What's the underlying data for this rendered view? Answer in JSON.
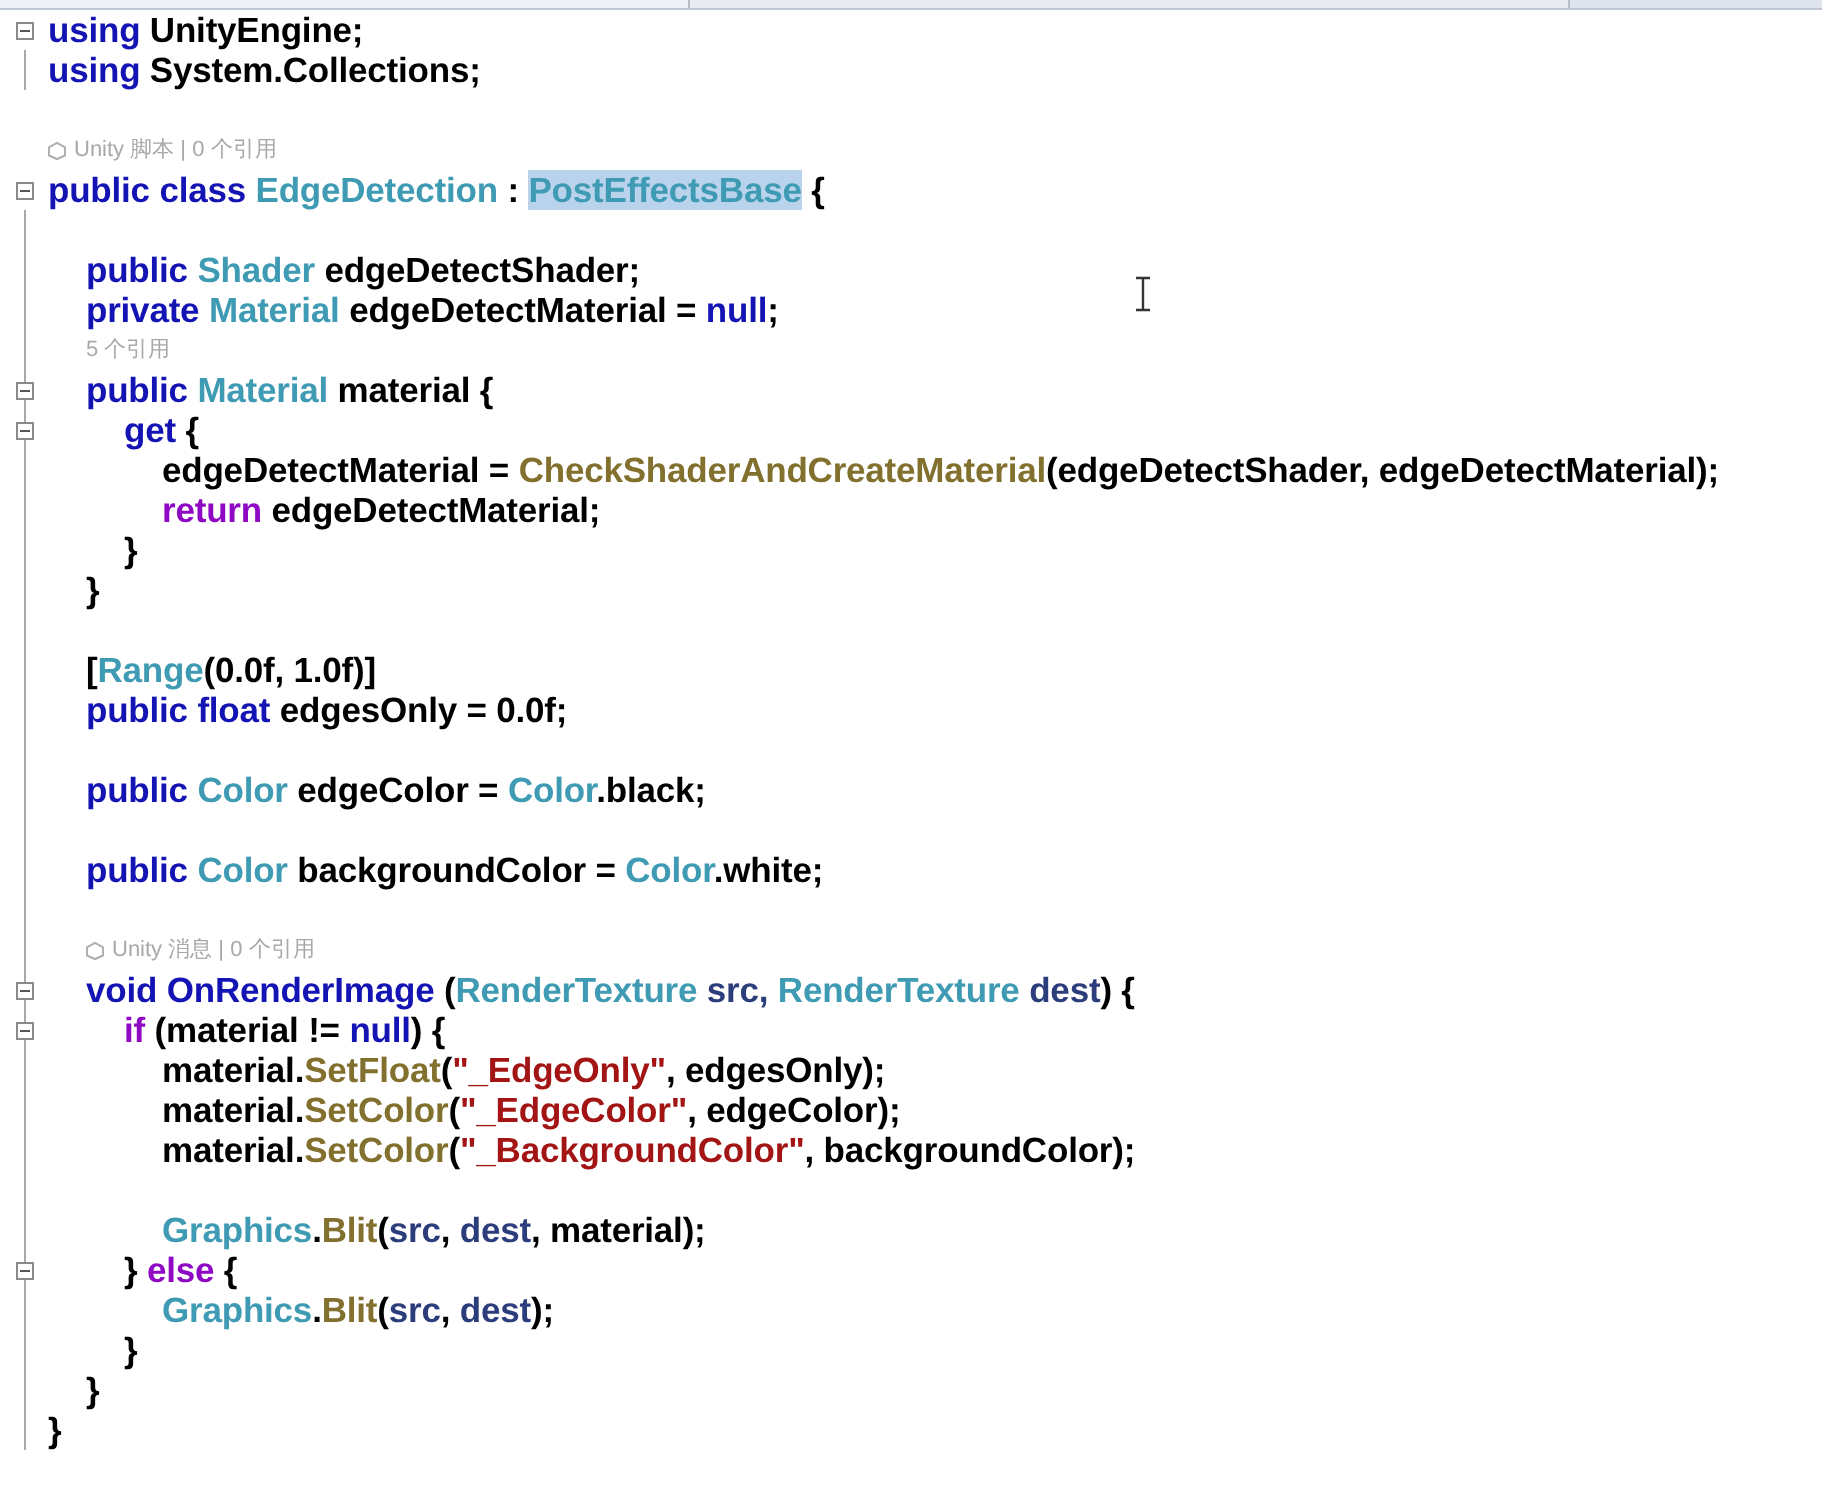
{
  "lines": [
    {
      "kind": "code",
      "fold_box": true,
      "outline": false,
      "tokens": [
        {
          "text": "using",
          "kind": "keyword"
        },
        {
          "text": " UnityEngine;",
          "kind": "plain"
        }
      ]
    },
    {
      "kind": "code",
      "fold_box": false,
      "outline": true,
      "tokens": [
        {
          "text": "using",
          "kind": "keyword"
        },
        {
          "text": " System.Collections;",
          "kind": "plain"
        }
      ]
    },
    {
      "kind": "blank",
      "fold_box": false,
      "outline": false
    },
    {
      "kind": "annotation",
      "fold_box": false,
      "outline": false,
      "indented": false,
      "unity_icon": true,
      "text": "Unity 脚本 | 0 个引用"
    },
    {
      "kind": "code",
      "fold_box": true,
      "outline": false,
      "tokens": [
        {
          "text": "public class",
          "kind": "keyword"
        },
        {
          "text": " EdgeDetection",
          "kind": "type"
        },
        {
          "text": " : ",
          "kind": "plain"
        },
        {
          "text": "PostEffectsBase",
          "kind": "selected_type"
        },
        {
          "text": " {",
          "kind": "plain"
        }
      ]
    },
    {
      "kind": "blank",
      "fold_box": false,
      "outline": true
    },
    {
      "kind": "code",
      "fold_box": false,
      "outline": true,
      "tokens": [
        {
          "text": "\tpublic",
          "kind": "keyword"
        },
        {
          "text": " Shader",
          "kind": "type"
        },
        {
          "text": " edgeDetectShader;",
          "kind": "plain"
        }
      ]
    },
    {
      "kind": "code",
      "fold_box": false,
      "outline": true,
      "tokens": [
        {
          "text": "\tprivate",
          "kind": "keyword"
        },
        {
          "text": " Material",
          "kind": "type"
        },
        {
          "text": " edgeDetectMaterial = ",
          "kind": "plain"
        },
        {
          "text": "null",
          "kind": "keyword"
        },
        {
          "text": ";",
          "kind": "plain"
        }
      ]
    },
    {
      "kind": "annotation",
      "fold_box": false,
      "outline": true,
      "indented": true,
      "unity_icon": false,
      "text": "5 个引用"
    },
    {
      "kind": "code",
      "fold_box": true,
      "outline": true,
      "tokens": [
        {
          "text": "\tpublic",
          "kind": "keyword"
        },
        {
          "text": " Material",
          "kind": "type"
        },
        {
          "text": " material {",
          "kind": "plain"
        }
      ]
    },
    {
      "kind": "code",
      "fold_box": true,
      "outline": true,
      "tokens": [
        {
          "text": "\t\tget",
          "kind": "keyword"
        },
        {
          "text": " {",
          "kind": "plain"
        }
      ]
    },
    {
      "kind": "code",
      "fold_box": false,
      "outline": true,
      "tokens": [
        {
          "text": "\t\t\tedgeDetectMaterial = ",
          "kind": "plain"
        },
        {
          "text": "CheckShaderAndCreateMaterial",
          "kind": "method"
        },
        {
          "text": "(edgeDetectShader, edgeDetectMaterial);",
          "kind": "plain"
        }
      ]
    },
    {
      "kind": "code",
      "fold_box": false,
      "outline": true,
      "tokens": [
        {
          "text": "\t\t\treturn",
          "kind": "control"
        },
        {
          "text": " edgeDetectMaterial;",
          "kind": "plain"
        }
      ]
    },
    {
      "kind": "code",
      "fold_box": false,
      "outline": true,
      "tokens": [
        {
          "text": "\t\t}",
          "kind": "plain"
        }
      ]
    },
    {
      "kind": "code",
      "fold_box": false,
      "outline": true,
      "tokens": [
        {
          "text": "\t}",
          "kind": "plain"
        }
      ]
    },
    {
      "kind": "blank",
      "fold_box": false,
      "outline": true
    },
    {
      "kind": "code",
      "fold_box": false,
      "outline": true,
      "tokens": [
        {
          "text": "\t[",
          "kind": "plain"
        },
        {
          "text": "Range",
          "kind": "type"
        },
        {
          "text": "(0.0f, 1.0f)]",
          "kind": "plain"
        }
      ]
    },
    {
      "kind": "code",
      "fold_box": false,
      "outline": true,
      "tokens": [
        {
          "text": "\tpublic float",
          "kind": "keyword"
        },
        {
          "text": " edgesOnly = 0.0f;",
          "kind": "plain"
        }
      ]
    },
    {
      "kind": "blank",
      "fold_box": false,
      "outline": true
    },
    {
      "kind": "code",
      "fold_box": false,
      "outline": true,
      "tokens": [
        {
          "text": "\tpublic",
          "kind": "keyword"
        },
        {
          "text": " Color",
          "kind": "type"
        },
        {
          "text": " edgeColor = ",
          "kind": "plain"
        },
        {
          "text": "Color",
          "kind": "type"
        },
        {
          "text": ".black;",
          "kind": "plain"
        }
      ]
    },
    {
      "kind": "blank",
      "fold_box": false,
      "outline": true
    },
    {
      "kind": "code",
      "fold_box": false,
      "outline": true,
      "tokens": [
        {
          "text": "\tpublic",
          "kind": "keyword"
        },
        {
          "text": " Color",
          "kind": "type"
        },
        {
          "text": " backgroundColor = ",
          "kind": "plain"
        },
        {
          "text": "Color",
          "kind": "type"
        },
        {
          "text": ".white;",
          "kind": "plain"
        }
      ]
    },
    {
      "kind": "blank",
      "fold_box": false,
      "outline": true
    },
    {
      "kind": "annotation",
      "fold_box": false,
      "outline": true,
      "indented": true,
      "unity_icon": true,
      "text": "Unity 消息 | 0 个引用"
    },
    {
      "kind": "code",
      "fold_box": true,
      "outline": true,
      "tokens": [
        {
          "text": "\tvoid OnRenderImage",
          "kind": "keyword"
        },
        {
          "text": " (",
          "kind": "plain"
        },
        {
          "text": "RenderTexture",
          "kind": "type"
        },
        {
          "text": " src, ",
          "kind": "param"
        },
        {
          "text": "RenderTexture",
          "kind": "type"
        },
        {
          "text": " dest",
          "kind": "param"
        },
        {
          "text": ") {",
          "kind": "plain"
        }
      ]
    },
    {
      "kind": "code",
      "fold_box": true,
      "outline": true,
      "tokens": [
        {
          "text": "\t\tif",
          "kind": "control"
        },
        {
          "text": " (material != ",
          "kind": "plain"
        },
        {
          "text": "null",
          "kind": "keyword"
        },
        {
          "text": ") {",
          "kind": "plain"
        }
      ]
    },
    {
      "kind": "code",
      "fold_box": false,
      "outline": true,
      "tokens": [
        {
          "text": "\t\t\tmaterial.",
          "kind": "plain"
        },
        {
          "text": "SetFloat",
          "kind": "method"
        },
        {
          "text": "(",
          "kind": "plain"
        },
        {
          "text": "\"_EdgeOnly\"",
          "kind": "string"
        },
        {
          "text": ", edgesOnly);",
          "kind": "plain"
        }
      ]
    },
    {
      "kind": "code",
      "fold_box": false,
      "outline": true,
      "tokens": [
        {
          "text": "\t\t\tmaterial.",
          "kind": "plain"
        },
        {
          "text": "SetColor",
          "kind": "method"
        },
        {
          "text": "(",
          "kind": "plain"
        },
        {
          "text": "\"_EdgeColor\"",
          "kind": "string"
        },
        {
          "text": ", edgeColor);",
          "kind": "plain"
        }
      ]
    },
    {
      "kind": "code",
      "fold_box": false,
      "outline": true,
      "tokens": [
        {
          "text": "\t\t\tmaterial.",
          "kind": "plain"
        },
        {
          "text": "SetColor",
          "kind": "method"
        },
        {
          "text": "(",
          "kind": "plain"
        },
        {
          "text": "\"_BackgroundColor\"",
          "kind": "string"
        },
        {
          "text": ", backgroundColor);",
          "kind": "plain"
        }
      ]
    },
    {
      "kind": "blank",
      "fold_box": false,
      "outline": true
    },
    {
      "kind": "code",
      "fold_box": false,
      "outline": true,
      "tokens": [
        {
          "text": "\t\t\tGraphics",
          "kind": "type"
        },
        {
          "text": ".",
          "kind": "plain"
        },
        {
          "text": "Blit",
          "kind": "method"
        },
        {
          "text": "(",
          "kind": "plain"
        },
        {
          "text": "src",
          "kind": "param"
        },
        {
          "text": ", ",
          "kind": "plain"
        },
        {
          "text": "dest",
          "kind": "param"
        },
        {
          "text": ", material);",
          "kind": "plain"
        }
      ]
    },
    {
      "kind": "code",
      "fold_box": true,
      "outline": true,
      "tokens": [
        {
          "text": "\t\t} ",
          "kind": "plain"
        },
        {
          "text": "else",
          "kind": "control"
        },
        {
          "text": " {",
          "kind": "plain"
        }
      ]
    },
    {
      "kind": "code",
      "fold_box": false,
      "outline": true,
      "tokens": [
        {
          "text": "\t\t\tGraphics",
          "kind": "type"
        },
        {
          "text": ".",
          "kind": "plain"
        },
        {
          "text": "Blit",
          "kind": "method"
        },
        {
          "text": "(",
          "kind": "plain"
        },
        {
          "text": "src",
          "kind": "param"
        },
        {
          "text": ", ",
          "kind": "plain"
        },
        {
          "text": "dest",
          "kind": "param"
        },
        {
          "text": ");",
          "kind": "plain"
        }
      ]
    },
    {
      "kind": "code",
      "fold_box": false,
      "outline": true,
      "tokens": [
        {
          "text": "\t\t}",
          "kind": "plain"
        }
      ]
    },
    {
      "kind": "code",
      "fold_box": false,
      "outline": true,
      "tokens": [
        {
          "text": "\t}",
          "kind": "plain"
        }
      ]
    },
    {
      "kind": "code",
      "fold_box": false,
      "outline": true,
      "tokens": [
        {
          "text": "}",
          "kind": "plain"
        }
      ]
    }
  ]
}
